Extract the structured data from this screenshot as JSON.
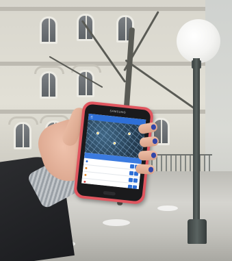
{
  "photo": {
    "subject": "hand-holding-smartphone",
    "phone": {
      "brand_label": "SAMSUNG",
      "case_color": "#e0565f",
      "app": {
        "bar_color": "#2e6fd6",
        "list_rows": 4
      }
    },
    "background": {
      "elements": [
        "building",
        "bare-tree",
        "street-lamp",
        "fence",
        "snowy-ground"
      ]
    },
    "nail_color": "#3246a8"
  }
}
